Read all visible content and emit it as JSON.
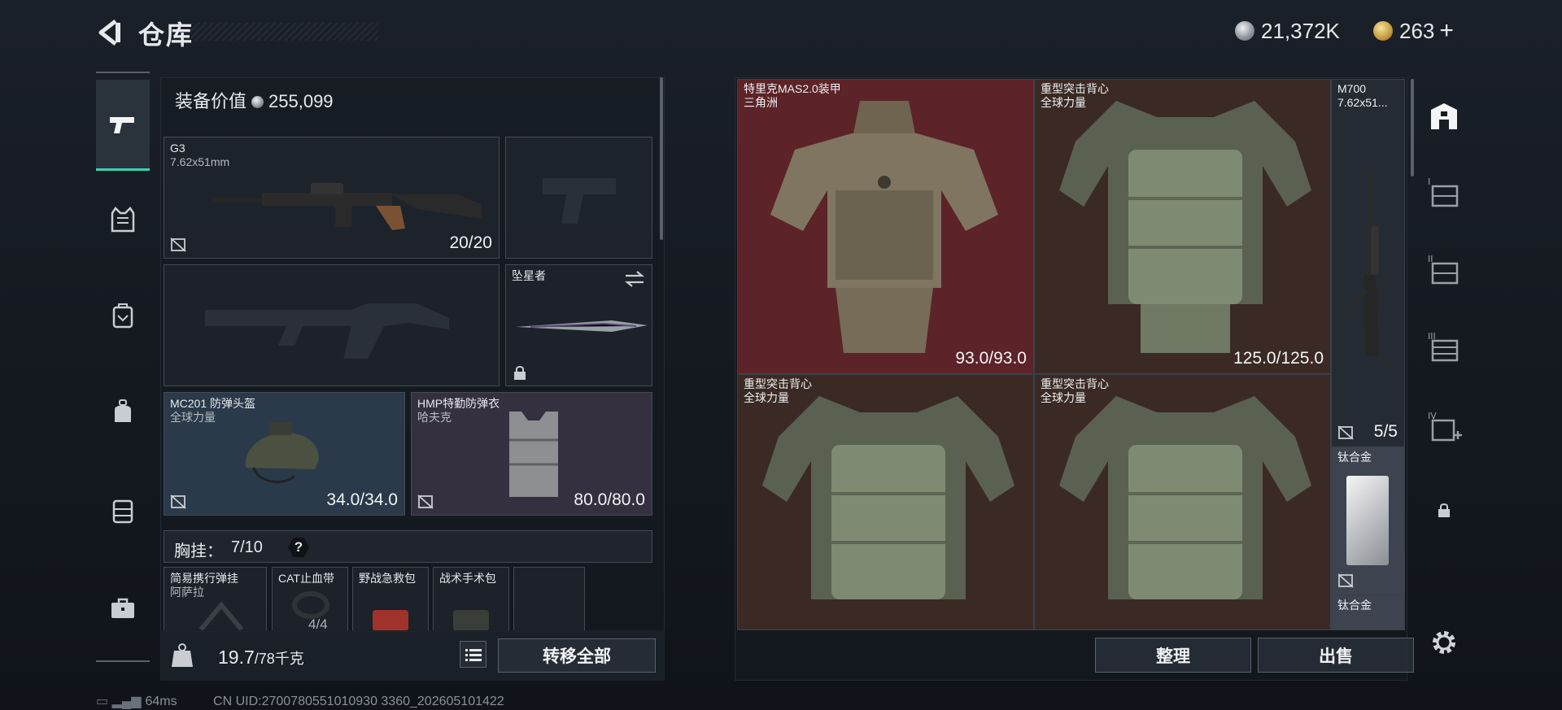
{
  "header": {
    "title": "仓库",
    "currency": {
      "silver": "21,372K",
      "gold": "263"
    }
  },
  "left_nav": {
    "icons": [
      "pistol-icon",
      "vest-icon",
      "backpack-case-icon",
      "backpack-icon",
      "chest-rig-icon",
      "briefcase-icon"
    ]
  },
  "loadout": {
    "equip_value_label": "装备价值",
    "equip_value": "255,099",
    "primary": {
      "name": "G3",
      "caliber": "7.62x51mm",
      "durability": "20/20"
    },
    "melee": {
      "name": "坠星者"
    },
    "helmet": {
      "name": "MC201 防弹头盔",
      "brand": "全球力量",
      "durability": "34.0/34.0"
    },
    "armor": {
      "name": "HMP特勤防弹衣",
      "brand": "哈夫克",
      "durability": "80.0/80.0"
    },
    "rig": {
      "label": "胸挂：",
      "capacity": "7/10",
      "help": "?"
    },
    "rig_items": [
      {
        "name": "简易携行弹挂",
        "brand": "阿萨拉"
      },
      {
        "name": "CAT止血带",
        "brand": "",
        "count": "4/4"
      },
      {
        "name": "野战急救包",
        "brand": ""
      },
      {
        "name": "战术手术包",
        "brand": ""
      }
    ],
    "weight_current": "19.7",
    "weight_max": "/78千克",
    "transfer_all": "转移全部"
  },
  "storage": {
    "items": [
      {
        "name": "特里克MAS2.0装甲",
        "brand": "三角洲",
        "durability": "93.0/93.0"
      },
      {
        "name": "重型突击背心",
        "brand": "全球力量",
        "durability": "125.0/125.0"
      },
      {
        "name": "重型突击背心",
        "brand": "全球力量",
        "durability": ""
      },
      {
        "name": "重型突击背心",
        "brand": "全球力量",
        "durability": ""
      }
    ],
    "side_items": [
      {
        "name": "M700",
        "caliber": "7.62x51...",
        "count": "5/5"
      },
      {
        "name": "钛合金"
      },
      {
        "name": "钛合金"
      }
    ],
    "organize": "整理",
    "sell": "出售"
  },
  "right_nav": {
    "tabs": [
      "I",
      "II",
      "III",
      "IV"
    ]
  },
  "footer": {
    "ping": "64ms",
    "uid": "CN UID:2700780551010930 3360_202605101422"
  },
  "colors": {
    "accent": "#37d3b0",
    "red_tile": "#5c2328",
    "brown_tile": "#3b2a24"
  }
}
